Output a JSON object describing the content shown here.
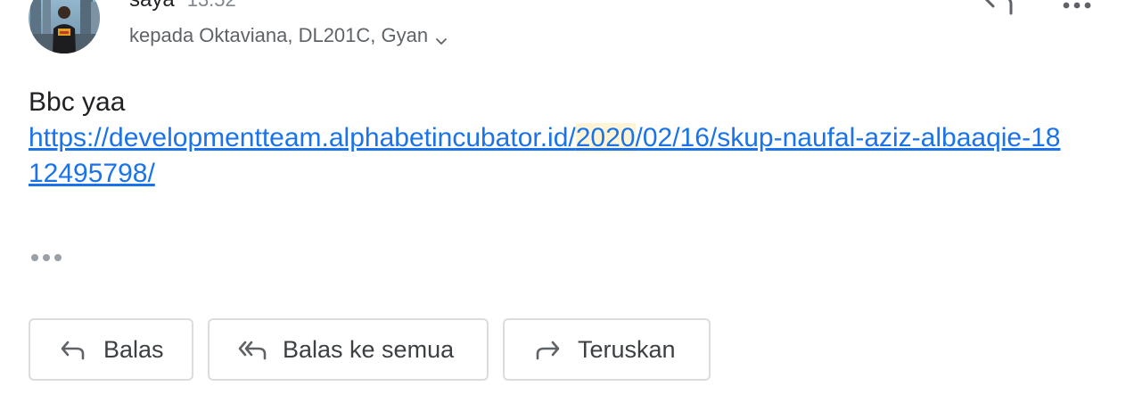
{
  "header": {
    "sender_name": "saya",
    "time": "13.52",
    "recipients": "kepada Oktaviana, DL201C, Gyan"
  },
  "message": {
    "text": "Bbc yaa",
    "link_before": "https://developmentteam.alphabetincubator.id/",
    "link_highlight": "2020",
    "link_after": "/02/16/skup-naufal-aziz-albaaqie-1812495798/"
  },
  "actions": {
    "reply_label": "Balas",
    "reply_all_label": "Balas ke semua",
    "forward_label": "Teruskan"
  },
  "colors": {
    "link": "#1a73e8",
    "highlight": "#fff5d6",
    "border": "#dadce0"
  }
}
